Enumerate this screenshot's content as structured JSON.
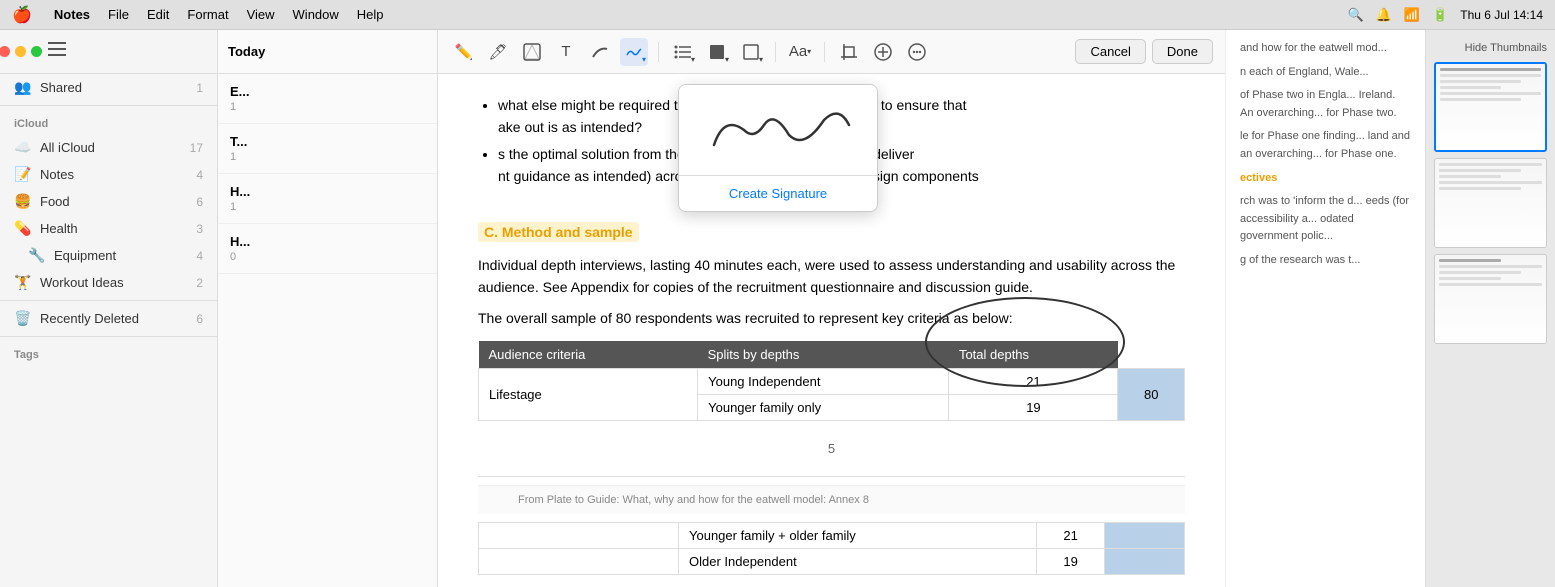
{
  "menubar": {
    "apple": "🍎",
    "items": [
      "Notes",
      "File",
      "Edit",
      "Format",
      "View",
      "Window",
      "Help"
    ],
    "notes_bold": "Notes",
    "right_icons": [
      "search",
      "notification",
      "time"
    ],
    "time": "Thu 6 Jul  14:14"
  },
  "sidebar": {
    "toolbar_icons": [
      "sidebar-toggle"
    ],
    "sections": {
      "shared_label": "Shared",
      "shared_count": "1",
      "icloud_label": "iCloud",
      "all_icloud_label": "All iCloud",
      "all_icloud_count": "17",
      "notes_label": "Notes",
      "notes_count": "4",
      "food_label": "Food",
      "food_count": "6",
      "health_label": "Health",
      "health_count": "3",
      "equipment_label": "Equipment",
      "equipment_count": "4",
      "workout_label": "Workout Ideas",
      "workout_count": "2",
      "recently_deleted_label": "Recently Deleted",
      "recently_deleted_count": "6",
      "tags_label": "Tags"
    }
  },
  "note_list": {
    "header": "Today",
    "items": [
      {
        "prefix": "E",
        "title": "E...",
        "date": "1"
      },
      {
        "prefix": "T",
        "title": "T...",
        "date": "1"
      },
      {
        "prefix": "H",
        "title": "H...",
        "date": "1"
      },
      {
        "prefix": "H",
        "title": "H...",
        "date": "0"
      }
    ]
  },
  "toolbar": {
    "cancel_label": "Cancel",
    "done_label": "Done",
    "icons": [
      "pen",
      "highlight",
      "shape",
      "text",
      "draw",
      "signature",
      "list",
      "square",
      "frame",
      "font",
      "crop",
      "plus",
      "more"
    ]
  },
  "signature_popup": {
    "create_label": "Create Signature"
  },
  "note_content": {
    "bullet1": "what else might be required to optimise the plate or support it to ensure that",
    "bullet1b": "ake out is as intended?",
    "bullet2": "s the optimal solution from the consumer perspective but (to deliver",
    "bullet2b": "nt guidance as intended) across the different designs and design components",
    "section_heading": "C.    Method and sample",
    "para1": "Individual depth interviews, lasting 40 minutes each, were used to assess understanding and usability across the audience. See Appendix for copies of the recruitment questionnaire and discussion guide.",
    "para2": "The overall sample of 80 respondents was recruited to represent key criteria as below:",
    "table": {
      "headers": [
        "Audience criteria",
        "Splits by depths",
        "Total depths"
      ],
      "rows": [
        {
          "criteria": "Lifestage",
          "split1": "Young Independent",
          "depth1": "21",
          "total": "80"
        },
        {
          "criteria": "",
          "split2": "Younger family only",
          "depth2": "19",
          "total": ""
        }
      ]
    },
    "page_number": "5",
    "footer_text": "From Plate to Guide: What, why and how for the eatwell model: Annex 8",
    "table2": {
      "rows": [
        {
          "split": "Younger family + older family",
          "depth": "21"
        },
        {
          "split": "Older Independent",
          "depth": "19"
        }
      ]
    }
  },
  "right_panel": {
    "text1": "and how for the eatwell mod...",
    "text2": "n each of England, Wale...",
    "text3": "of Phase two in Engla... Ireland. An overarching... for Phase two.",
    "text4": "le for Phase one finding... land and an overarching... for Phase one.",
    "text5_heading": "ectives",
    "text6": "rch was to 'inform the d... eeds (for accessibility a... odated government polic...",
    "text7": "g of the research was t..."
  },
  "thumbnail_panel": {
    "hide_label": "Hide Thumbnails"
  }
}
